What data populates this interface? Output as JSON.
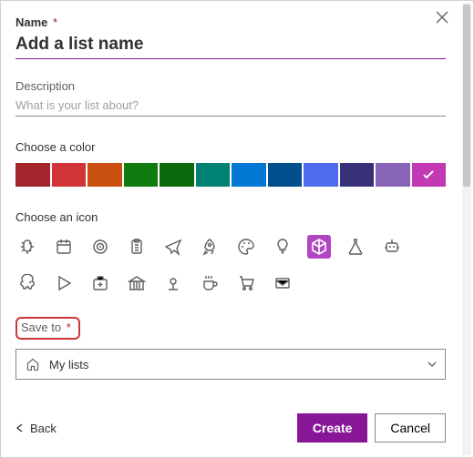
{
  "header": {
    "name_label": "Name",
    "name_required": "*",
    "name_placeholder": "Add a list name",
    "name_value": "",
    "description_label": "Description",
    "description_placeholder": "What is your list about?",
    "description_value": ""
  },
  "color_section": {
    "label": "Choose a color",
    "colors": [
      {
        "name": "dark-red",
        "hex": "#a4262c",
        "selected": false
      },
      {
        "name": "red",
        "hex": "#d13438",
        "selected": false
      },
      {
        "name": "orange",
        "hex": "#ca5010",
        "selected": false
      },
      {
        "name": "green",
        "hex": "#107c10",
        "selected": false
      },
      {
        "name": "dark-green",
        "hex": "#0b6a0b",
        "selected": false
      },
      {
        "name": "teal",
        "hex": "#008272",
        "selected": false
      },
      {
        "name": "blue",
        "hex": "#0078d4",
        "selected": false
      },
      {
        "name": "dark-blue",
        "hex": "#004e8c",
        "selected": false
      },
      {
        "name": "indigo",
        "hex": "#4f6bed",
        "selected": false
      },
      {
        "name": "navy",
        "hex": "#373277",
        "selected": false
      },
      {
        "name": "purple",
        "hex": "#8764b8",
        "selected": false
      },
      {
        "name": "pink",
        "hex": "#c239b3",
        "selected": true
      }
    ]
  },
  "icon_section": {
    "label": "Choose an icon",
    "icons": [
      {
        "name": "bug-icon",
        "selected": false
      },
      {
        "name": "calendar-icon",
        "selected": false
      },
      {
        "name": "target-icon",
        "selected": false
      },
      {
        "name": "clipboard-icon",
        "selected": false
      },
      {
        "name": "airplane-icon",
        "selected": false
      },
      {
        "name": "rocket-icon",
        "selected": false
      },
      {
        "name": "palette-icon",
        "selected": false
      },
      {
        "name": "lightbulb-icon",
        "selected": false
      },
      {
        "name": "cube-icon",
        "selected": true
      },
      {
        "name": "flask-icon",
        "selected": false
      },
      {
        "name": "robot-icon",
        "selected": false
      },
      {
        "name": "piggybank-icon",
        "selected": false
      },
      {
        "name": "play-icon",
        "selected": false
      },
      {
        "name": "firstaid-icon",
        "selected": false
      },
      {
        "name": "bank-icon",
        "selected": false
      },
      {
        "name": "location-icon",
        "selected": false
      },
      {
        "name": "coffee-icon",
        "selected": false
      },
      {
        "name": "cart-icon",
        "selected": false
      },
      {
        "name": "mail-icon",
        "selected": false
      }
    ]
  },
  "saveto": {
    "label": "Save to",
    "required": "*",
    "selected": "My lists"
  },
  "footer": {
    "back": "Back",
    "create": "Create",
    "cancel": "Cancel"
  }
}
